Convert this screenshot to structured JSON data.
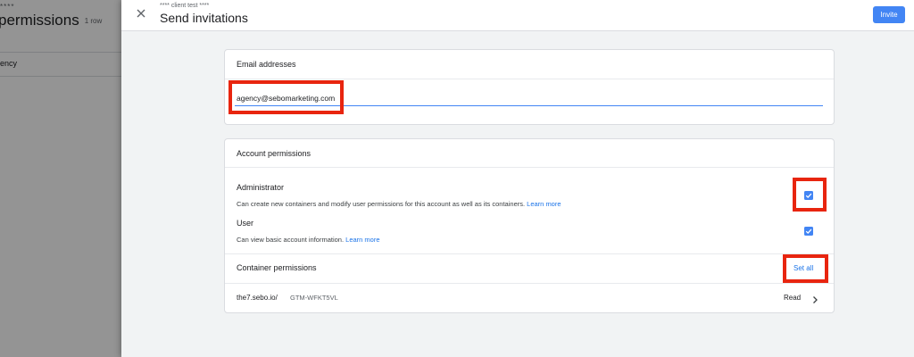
{
  "background_page": {
    "subtitle": "****",
    "title": "permissions",
    "row_count": "1 row",
    "row_label": "ency"
  },
  "header": {
    "subtitle": "**** client test ****",
    "title": "Send invitations",
    "invite_label": "Invite",
    "close_icon": "close-icon"
  },
  "email_card": {
    "header": "Email addresses",
    "email_value": "agency@sebomarketing.com"
  },
  "account_permissions": {
    "header": "Account permissions",
    "roles": [
      {
        "name": "Administrator",
        "description": "Can create new containers and modify user permissions for this account as well as its containers.",
        "link": "Learn more",
        "checked": true
      },
      {
        "name": "User",
        "description": "Can view basic account information.",
        "link": "Learn more",
        "checked": true
      }
    ]
  },
  "container_permissions": {
    "header": "Container permissions",
    "set_all_label": "Set all",
    "containers": [
      {
        "name": "the7.sebo.io/",
        "id": "GTM-WFKT5VL",
        "role": "Read",
        "chevron_icon": "chevron-right-icon"
      }
    ]
  },
  "colors": {
    "accent": "#4285f4",
    "link": "#1a73e8",
    "highlight": "#e8250f"
  }
}
